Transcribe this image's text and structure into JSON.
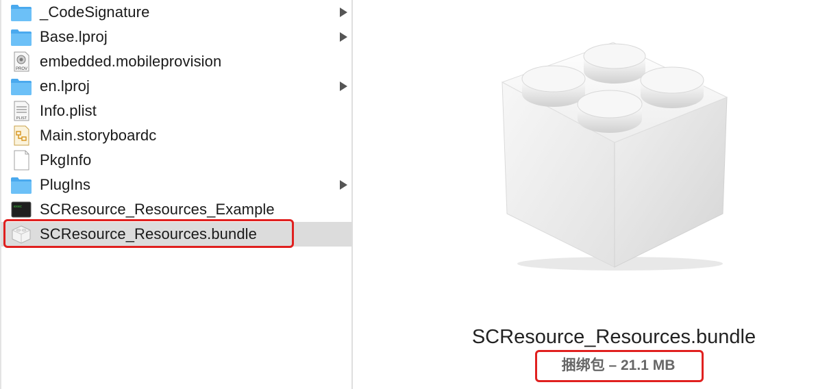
{
  "files": [
    {
      "name": "_CodeSignature",
      "icon": "folder-icon",
      "expandable": true
    },
    {
      "name": "Base.lproj",
      "icon": "folder-icon",
      "expandable": true
    },
    {
      "name": "embedded.mobileprovision",
      "icon": "provisioning-profile-icon",
      "icon_caption": "PROV",
      "expandable": false
    },
    {
      "name": "en.lproj",
      "icon": "folder-icon",
      "expandable": true
    },
    {
      "name": "Info.plist",
      "icon": "plist-document-icon",
      "icon_caption": "PLIST",
      "expandable": false
    },
    {
      "name": "Main.storyboardc",
      "icon": "storyboard-icon",
      "expandable": false
    },
    {
      "name": "PkgInfo",
      "icon": "blank-document-icon",
      "expandable": false
    },
    {
      "name": "PlugIns",
      "icon": "folder-icon",
      "expandable": true
    },
    {
      "name": "SCResource_Resources_Example",
      "icon": "terminal-executable-icon",
      "expandable": false
    },
    {
      "name": "SCResource_Resources.bundle",
      "icon": "bundle-icon",
      "expandable": false,
      "selected": true
    }
  ],
  "preview": {
    "name": "SCResource_Resources.bundle",
    "info": "捆绑包 – 21.1 MB",
    "icon": "bundle-lego-brick-icon"
  },
  "colors": {
    "folder": "#5fb8f4",
    "selection": "#dcdcdc",
    "highlight_outline": "#e0201f"
  }
}
